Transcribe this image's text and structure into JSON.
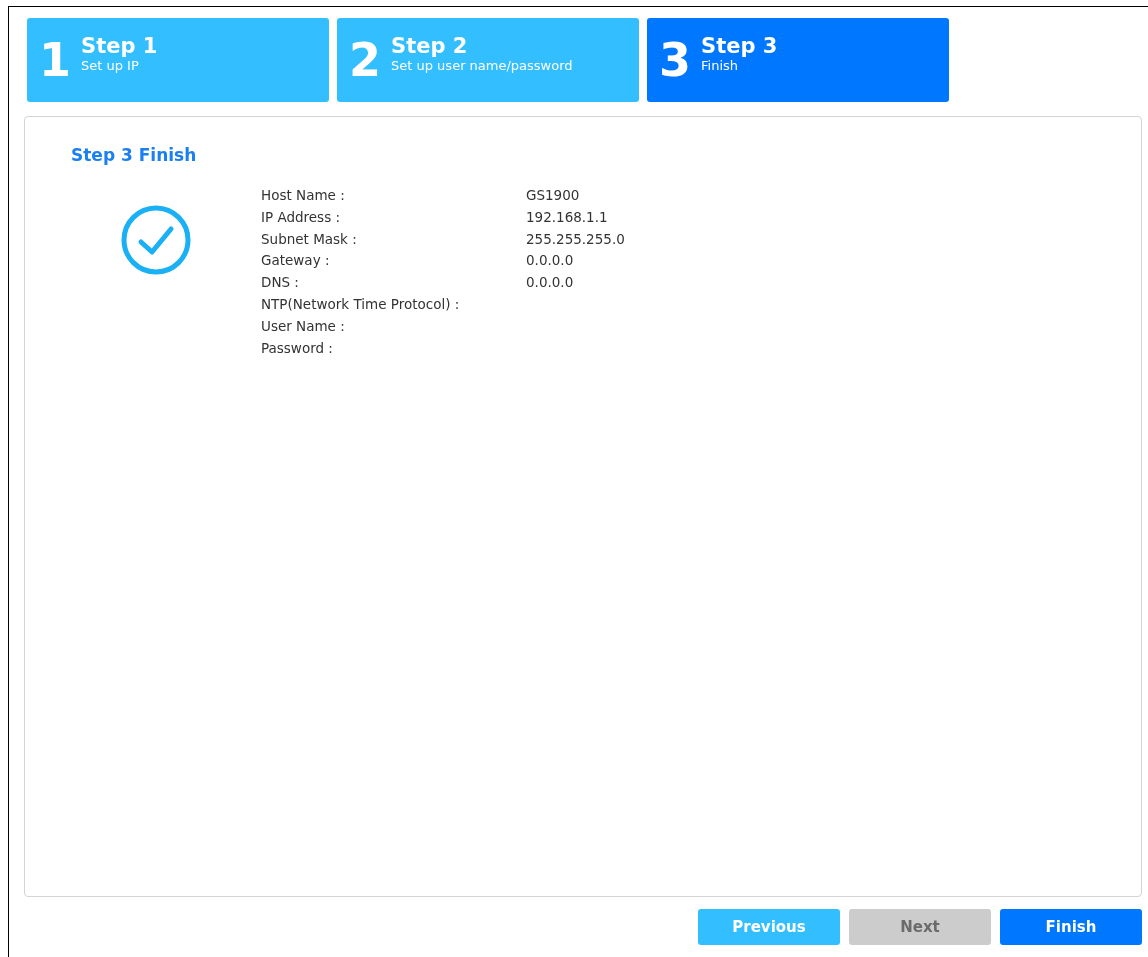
{
  "steps": [
    {
      "number": "1",
      "title": "Step 1",
      "subtitle": "Set up IP",
      "selected": false
    },
    {
      "number": "2",
      "title": "Step 2",
      "subtitle": "Set up user name/password",
      "selected": false
    },
    {
      "number": "3",
      "title": "Step 3",
      "subtitle": "Finish",
      "selected": true
    }
  ],
  "panel": {
    "heading": "Step 3 Finish",
    "fields": [
      {
        "label": "Host Name :",
        "value": "GS1900"
      },
      {
        "label": "IP Address :",
        "value": "192.168.1.1"
      },
      {
        "label": "Subnet Mask :",
        "value": "255.255.255.0"
      },
      {
        "label": "Gateway :",
        "value": "0.0.0.0"
      },
      {
        "label": "DNS :",
        "value": "0.0.0.0"
      },
      {
        "label": "NTP(Network Time Protocol) :"
      },
      {
        "label": "User Name :"
      },
      {
        "label": "Password :"
      }
    ]
  },
  "buttons": [
    {
      "label": "Previous",
      "kind": "secondary",
      "disabled": false
    },
    {
      "label": "Next",
      "kind": "secondary",
      "disabled": true
    },
    {
      "label": "Finish",
      "kind": "primary",
      "disabled": false
    }
  ]
}
